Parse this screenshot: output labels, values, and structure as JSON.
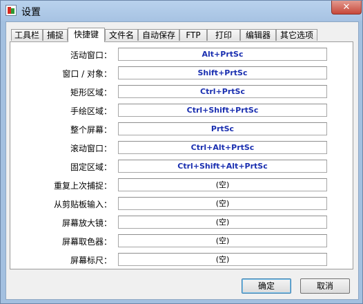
{
  "window": {
    "title": "设置",
    "close_glyph": "✕"
  },
  "tabs": [
    {
      "label": "工具栏"
    },
    {
      "label": "捕捉"
    },
    {
      "label": "快捷键",
      "active": true
    },
    {
      "label": "文件名"
    },
    {
      "label": "自动保存"
    },
    {
      "label": "FTP"
    },
    {
      "label": "打印"
    },
    {
      "label": "编辑器"
    },
    {
      "label": "其它选项"
    }
  ],
  "hotkeys": [
    {
      "label": "活动窗口：",
      "value": "Alt+PrtSc"
    },
    {
      "label": "窗口 / 对象：",
      "value": "Shift+PrtSc"
    },
    {
      "label": "矩形区域：",
      "value": "Ctrl+PrtSc"
    },
    {
      "label": "手绘区域：",
      "value": "Ctrl+Shift+PrtSc"
    },
    {
      "label": "整个屏幕：",
      "value": "PrtSc"
    },
    {
      "label": "滚动窗口：",
      "value": "Ctrl+Alt+PrtSc"
    },
    {
      "label": "固定区域：",
      "value": "Ctrl+Shift+Alt+PrtSc"
    },
    {
      "label": "重复上次捕捉：",
      "value": "(空)"
    },
    {
      "label": "从剪贴板输入：",
      "value": "(空)"
    },
    {
      "label": "屏幕放大镜：",
      "value": "(空)"
    },
    {
      "label": "屏幕取色器：",
      "value": "(空)"
    },
    {
      "label": "屏幕标尺：",
      "value": "(空)"
    }
  ],
  "buttons": {
    "ok": "确定",
    "cancel": "取消"
  },
  "colors": {
    "hotkey_text": "#1a2fb0",
    "frame": "#a3c0e0"
  }
}
